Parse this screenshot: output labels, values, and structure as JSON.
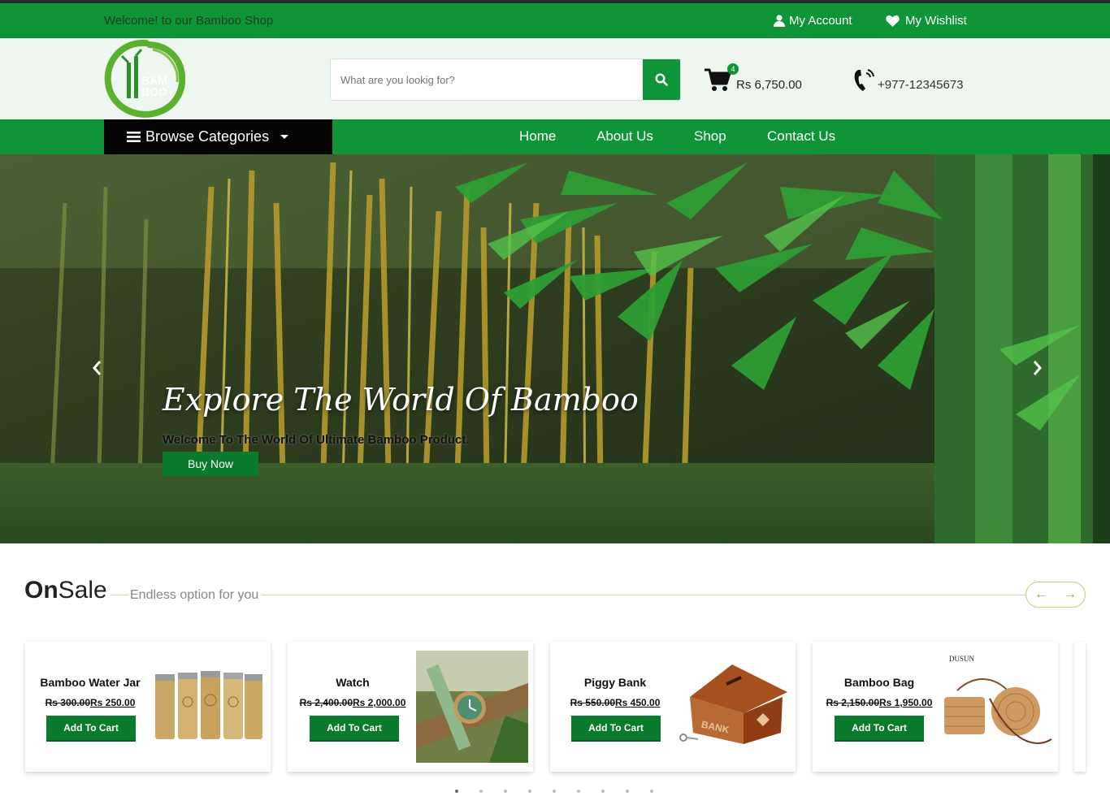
{
  "topbar": {
    "welcome": "Welcome! to our Bamboo Shop",
    "account_label": "My Account",
    "wishlist_label": "My Wishlist"
  },
  "logo": {
    "text_top": "BAM",
    "text_bottom": "BOO"
  },
  "search": {
    "placeholder": "What are you lookig for?",
    "button_icon": "search-icon"
  },
  "cart": {
    "count": "4",
    "total": "Rs 6,750.00"
  },
  "contact": {
    "phone": "+977-12345673"
  },
  "nav": {
    "browse_label": "Browse Categories",
    "links": [
      "Home",
      "About Us",
      "Shop",
      "Contact Us"
    ]
  },
  "hero": {
    "title": "Explore The World Of Bamboo",
    "subtitle": "Welcome To The World Of Ultimate Bamboo Product.",
    "cta": "Buy Now"
  },
  "section": {
    "title_bold": "On",
    "title_rest": "Sale",
    "subtitle": "Endless option for you",
    "prev": "←",
    "next": "→"
  },
  "products": [
    {
      "name": "Bamboo Water Jar",
      "old_price": "Rs 300.00",
      "new_price": "Rs 250.00",
      "button": "Add To Cart"
    },
    {
      "name": "Watch",
      "old_price": "Rs 2,400.00",
      "new_price": "Rs 2,000.00",
      "button": "Add To Cart"
    },
    {
      "name": "Piggy Bank",
      "old_price": "Rs 550.00",
      "new_price": "Rs 450.00",
      "button": "Add To Cart",
      "image_text": "BANK"
    },
    {
      "name": "Bamboo Bag",
      "old_price": "Rs 2,150.00",
      "new_price": "Rs 1,950.00",
      "button": "Add To Cart",
      "brand_mark": "DUSUN"
    }
  ],
  "colors": {
    "brand_green": "#0f9438",
    "dark_green": "#0a7a2c",
    "header_bg": "#eef7ef"
  }
}
